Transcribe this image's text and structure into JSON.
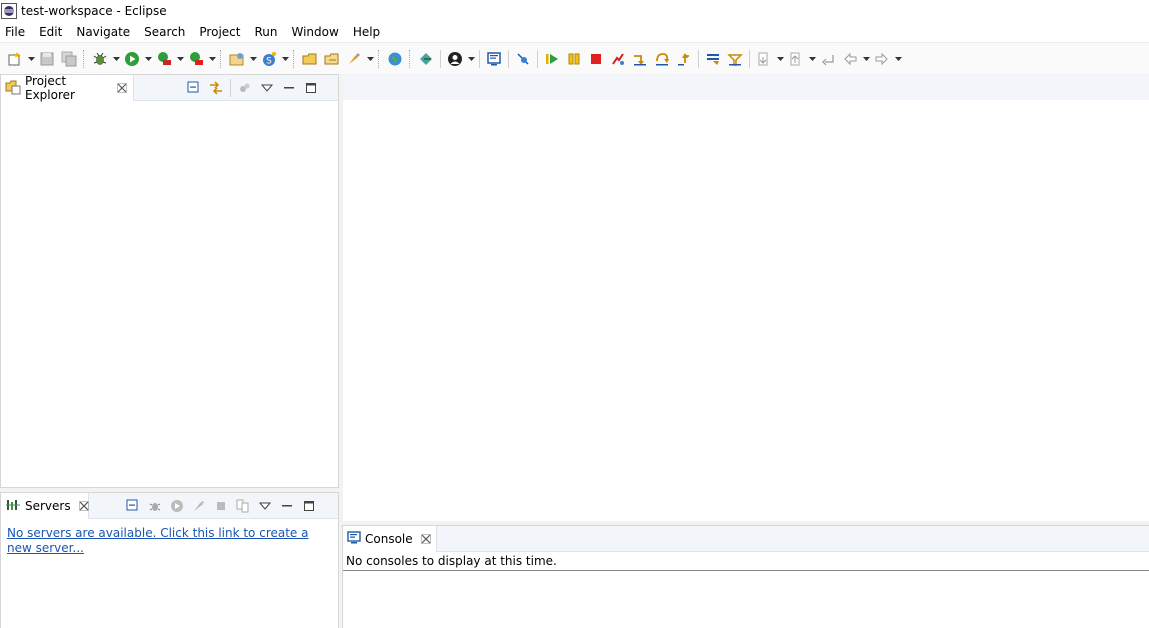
{
  "window": {
    "title": "test-workspace - Eclipse",
    "icon": "eclipse-icon"
  },
  "menu": {
    "items": [
      "File",
      "Edit",
      "Navigate",
      "Search",
      "Project",
      "Run",
      "Window",
      "Help"
    ]
  },
  "toolbar": {
    "icons": [
      "new-wizard-icon",
      "save-icon",
      "save-all-icon",
      "debug-icon",
      "run-icon",
      "run-coverage-icon",
      "run-external-tool-icon",
      "new-java-project-icon",
      "new-class-icon",
      "open-type-icon",
      "open-task-icon",
      "search-icon",
      "open-web-browser-icon",
      "deploy-icon",
      "profile-icon",
      "console-icon",
      "skip-breakpoints-icon",
      "resume-icon",
      "suspend-icon",
      "terminate-icon",
      "disconnect-icon",
      "step-into-icon",
      "step-over-icon",
      "step-return-icon",
      "drop-to-frame-icon",
      "use-step-filters-icon",
      "next-annotation-icon",
      "previous-annotation-icon",
      "last-edit-location-icon",
      "back-icon",
      "forward-icon"
    ]
  },
  "project_explorer": {
    "tab_label": "Project Explorer"
  },
  "servers": {
    "tab_label": "Servers",
    "empty_link": "No servers are available. Click this link to create a new server..."
  },
  "console": {
    "tab_label": "Console",
    "empty_message": "No consoles to display at this time."
  },
  "colors": {
    "accent_link": "#1a55b3",
    "tab_strip": "#f2f5f9",
    "run_green": "#2e9d3a",
    "terminate_red": "#e02020"
  }
}
